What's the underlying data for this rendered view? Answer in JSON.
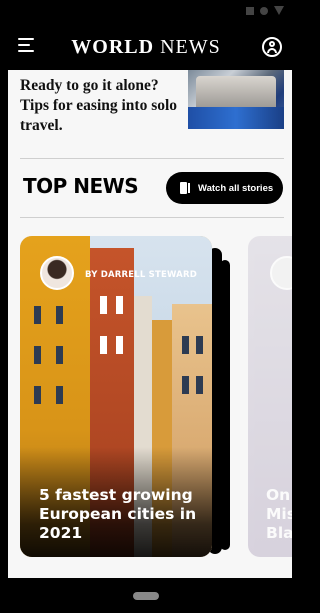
{
  "app": {
    "brand_bold": "WORLD",
    "brand_regular": " NEWS"
  },
  "top_story": {
    "title": "Ready to go it alone? Tips for easing into solo travel."
  },
  "section": {
    "title": "TOP NEWS",
    "watch_label": "Watch all stories"
  },
  "cards": [
    {
      "byline": "BY DARRELL STEWARD",
      "headline": "5 fastest growing European cities in 2021"
    },
    {
      "headline": "On\nMis\nBla"
    }
  ],
  "icons": {
    "menu": "menu-icon",
    "account": "account-icon",
    "watch": "video-icon"
  }
}
